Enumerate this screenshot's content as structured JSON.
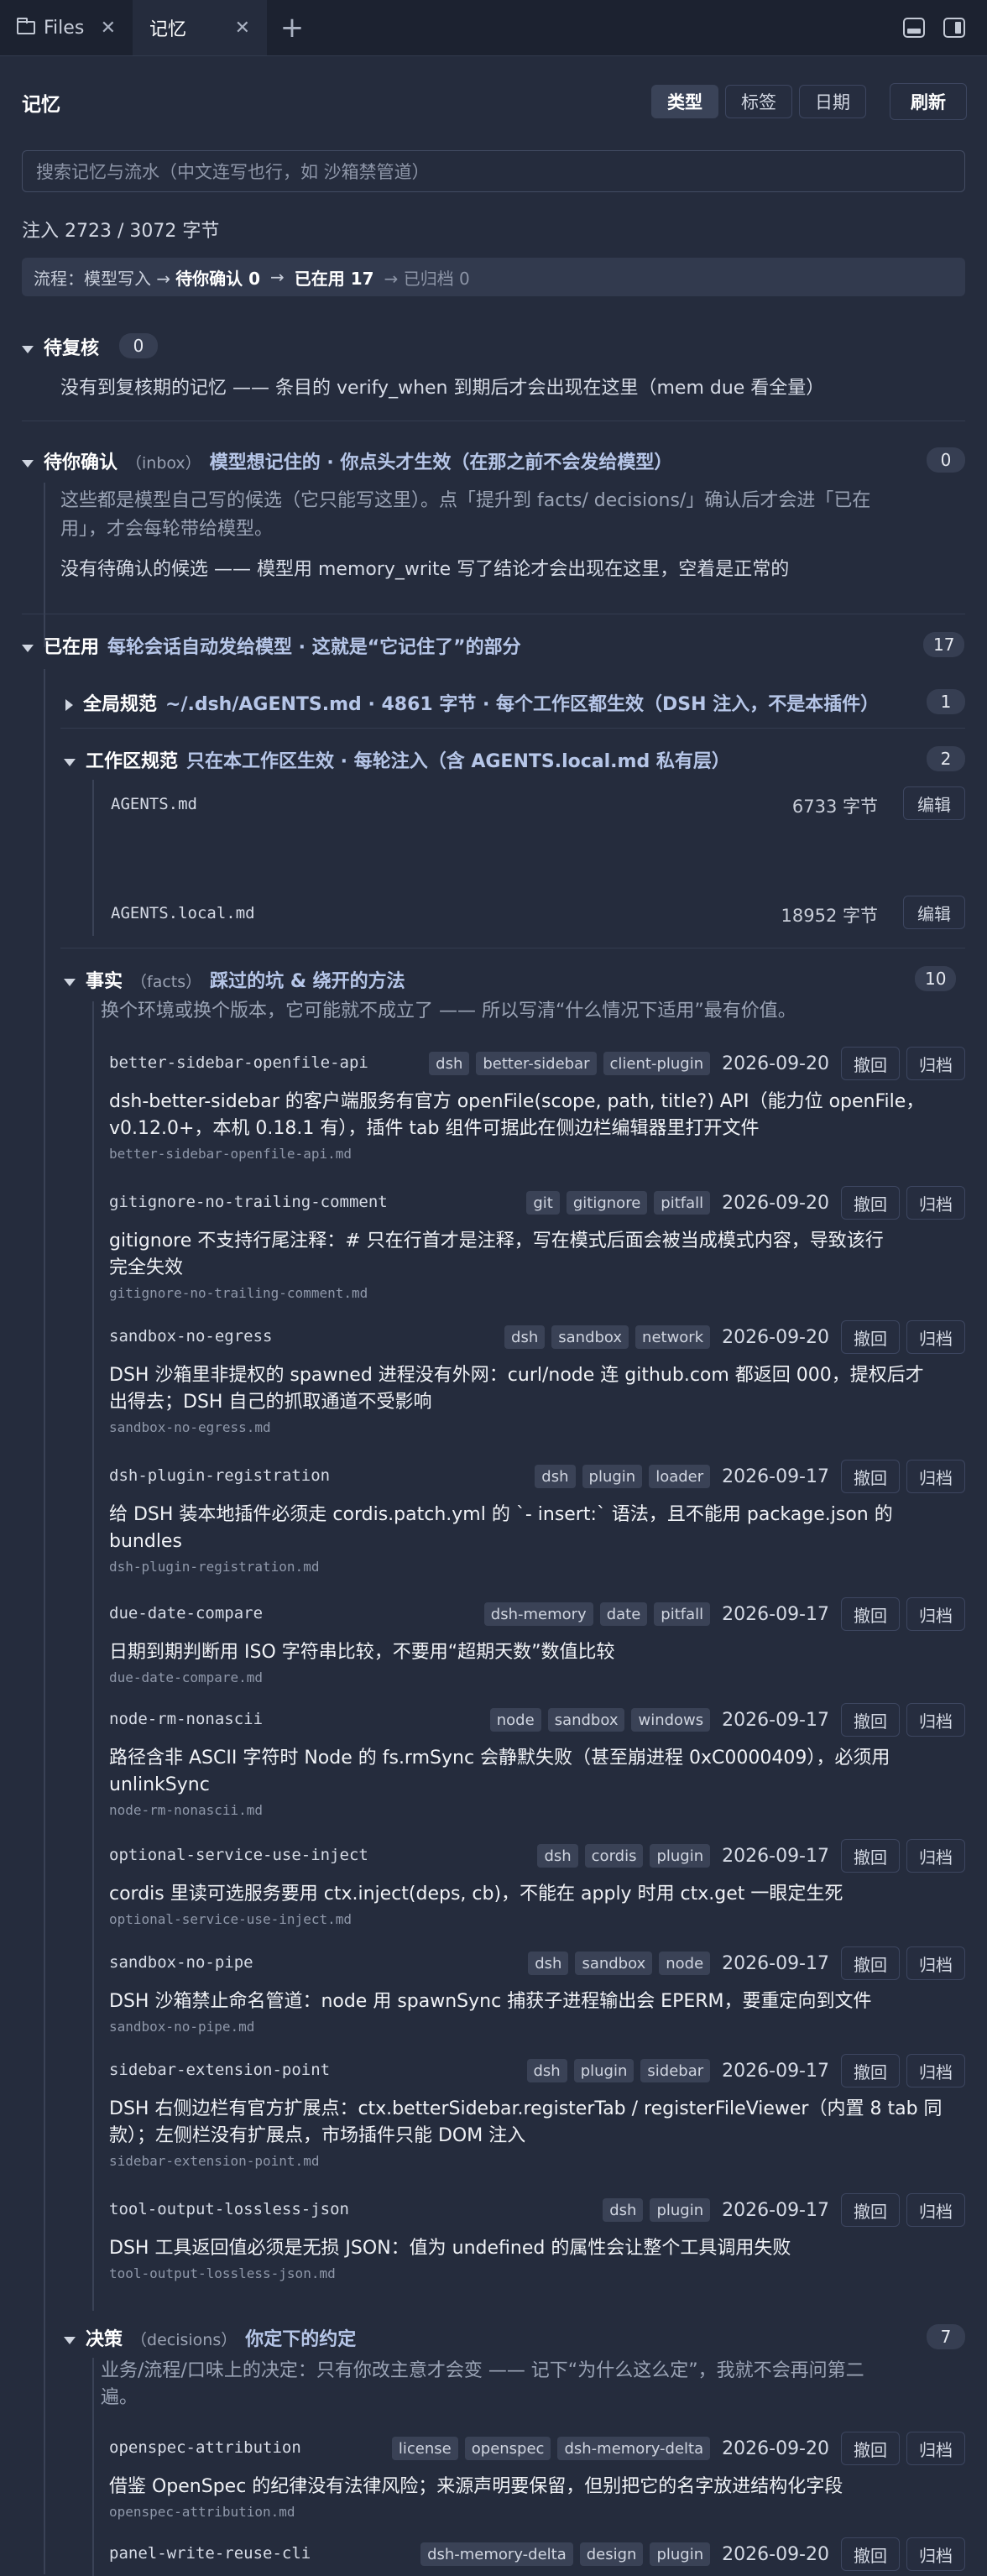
{
  "tabs": [
    {
      "label": "Files",
      "icon": "folder-icon"
    },
    {
      "label": "记忆"
    }
  ],
  "header": {
    "title": "记忆",
    "buttons": [
      "类型",
      "标签",
      "日期"
    ],
    "refresh": "刷新"
  },
  "search": {
    "placeholder": "搜索记忆与流水（中文连写也行，如 沙箱禁管道）"
  },
  "stat": "注入 2723 / 3072 字节",
  "flow": {
    "prefix": "流程：模型写入 →",
    "pending": "待你确认 0",
    "arrow1": "→",
    "active": "已在用 17",
    "arrow2": "→ 已归档 0"
  },
  "review": {
    "title": "待复核",
    "count": "0",
    "text": "没有到复核期的记忆 —— 条目的 verify_when 到期后才会出现在这里（mem due 看全量）"
  },
  "inbox": {
    "title": "待你确认",
    "paren": "（inbox）",
    "desc": "模型想记住的 · 你点头才生效（在那之前不会发给模型）",
    "count": "0",
    "text1": "这些都是模型自己写的候选（它只能写这里）。点「提升到 facts/ decisions/」确认后才会进「已在",
    "text2": "用」，才会每轮带给模型。",
    "text3": "没有待确认的候选 —— 模型用 memory_write 写了结论才会出现在这里，空着是正常的"
  },
  "active": {
    "title": "已在用",
    "desc": "每轮会话自动发给模型 · 这就是“它记住了”的部分",
    "count": "17"
  },
  "global": {
    "title": "全局规范",
    "desc": "~/.dsh/AGENTS.md · 4861 字节 · 每个工作区都生效（DSH 注入，不是本插件）",
    "count": "1"
  },
  "workspace": {
    "title": "工作区规范",
    "desc": "只在本工作区生效 · 每轮注入（含 AGENTS.local.md 私有层）",
    "count": "2",
    "files": [
      {
        "name": "AGENTS.md",
        "size": "6733 字节",
        "edit": "编辑"
      },
      {
        "name": "AGENTS.local.md",
        "size": "18952 字节",
        "edit": "编辑"
      }
    ]
  },
  "facts": {
    "title": "事实",
    "paren": "（facts）",
    "desc": "踩过的坑 & 绕开的方法",
    "count": "10",
    "hint": "换个环境或换个版本，它可能就不成立了 —— 所以写清“什么情况下适用”最有价值。",
    "actions": {
      "withdraw": "撤回",
      "archive": "归档"
    },
    "items": [
      {
        "key": "better-sidebar-openfile-api",
        "tags": [
          "dsh",
          "better-sidebar",
          "client-plugin"
        ],
        "date": "2026-09-20",
        "lines": [
          "dsh-better-sidebar 的客户端服务有官方 openFile(scope, path, title?) API（能力位 openFile，",
          "v0.12.0+，本机 0.18.1 有），插件 tab 组件可据此在侧边栏编辑器里打开文件"
        ],
        "file": "better-sidebar-openfile-api.md"
      },
      {
        "key": "gitignore-no-trailing-comment",
        "tags": [
          "git",
          "gitignore",
          "pitfall"
        ],
        "date": "2026-09-20",
        "lines": [
          "gitignore 不支持行尾注释：# 只在行首才是注释，写在模式后面会被当成模式内容，导致该行",
          "完全失效"
        ],
        "file": "gitignore-no-trailing-comment.md"
      },
      {
        "key": "sandbox-no-egress",
        "tags": [
          "dsh",
          "sandbox",
          "network"
        ],
        "date": "2026-09-20",
        "lines": [
          "DSH 沙箱里非提权的 spawned 进程没有外网：curl/node 连 github.com 都返回 000，提权后才",
          "出得去；DSH 自己的抓取通道不受影响"
        ],
        "file": "sandbox-no-egress.md"
      },
      {
        "key": "dsh-plugin-registration",
        "tags": [
          "dsh",
          "plugin",
          "loader"
        ],
        "date": "2026-09-17",
        "lines": [
          "给 DSH 装本地插件必须走 cordis.patch.yml 的 `- insert:` 语法，且不能用 package.json 的",
          "bundles"
        ],
        "file": "dsh-plugin-registration.md"
      },
      {
        "key": "due-date-compare",
        "tags": [
          "dsh-memory",
          "date",
          "pitfall"
        ],
        "date": "2026-09-17",
        "lines": [
          "日期到期判断用 ISO 字符串比较，不要用“超期天数”数值比较"
        ],
        "file": "due-date-compare.md"
      },
      {
        "key": "node-rm-nonascii",
        "tags": [
          "node",
          "sandbox",
          "windows"
        ],
        "date": "2026-09-17",
        "lines": [
          "路径含非 ASCII 字符时 Node 的 fs.rmSync 会静默失败（甚至崩进程 0xC0000409），必须用",
          "unlinkSync"
        ],
        "file": "node-rm-nonascii.md"
      },
      {
        "key": "optional-service-use-inject",
        "tags": [
          "dsh",
          "cordis",
          "plugin"
        ],
        "date": "2026-09-17",
        "lines": [
          "cordis 里读可选服务要用 ctx.inject(deps, cb)，不能在 apply 时用 ctx.get 一眼定生死"
        ],
        "file": "optional-service-use-inject.md"
      },
      {
        "key": "sandbox-no-pipe",
        "tags": [
          "dsh",
          "sandbox",
          "node"
        ],
        "date": "2026-09-17",
        "lines": [
          "DSH 沙箱禁止命名管道：node 用 spawnSync 捕获子进程输出会 EPERM，要重定向到文件"
        ],
        "file": "sandbox-no-pipe.md"
      },
      {
        "key": "sidebar-extension-point",
        "tags": [
          "dsh",
          "plugin",
          "sidebar"
        ],
        "date": "2026-09-17",
        "lines": [
          "DSH 右侧边栏有官方扩展点：ctx.betterSidebar.registerTab / registerFileViewer（内置 8 tab 同",
          "款）；左侧栏没有扩展点，市场插件只能 DOM 注入"
        ],
        "file": "sidebar-extension-point.md"
      },
      {
        "key": "tool-output-lossless-json",
        "tags": [
          "dsh",
          "plugin"
        ],
        "date": "2026-09-17",
        "lines": [
          "DSH 工具返回值必须是无损 JSON：值为 undefined 的属性会让整个工具调用失败"
        ],
        "file": "tool-output-lossless-json.md"
      }
    ]
  },
  "decisions": {
    "title": "决策",
    "paren": "（decisions）",
    "desc": "你定下的约定",
    "count": "7",
    "hint1": "业务/流程/口味上的决定：只有你改主意才会变 —— 记下“为什么这么定”，我就不会再问第二",
    "hint2": "遍。",
    "items": [
      {
        "key": "openspec-attribution",
        "tags": [
          "license",
          "openspec",
          "dsh-memory-delta"
        ],
        "date": "2026-09-20",
        "lines": [
          "借鉴 OpenSpec 的纪律没有法律风险；来源声明要保留，但别把它的名字放进结构化字段"
        ],
        "file": "openspec-attribution.md"
      },
      {
        "key": "panel-write-reuse-cli",
        "tags": [
          "dsh-memory-delta",
          "design",
          "plugin"
        ],
        "date": "2026-09-20",
        "lines": [],
        "file": ""
      }
    ]
  }
}
